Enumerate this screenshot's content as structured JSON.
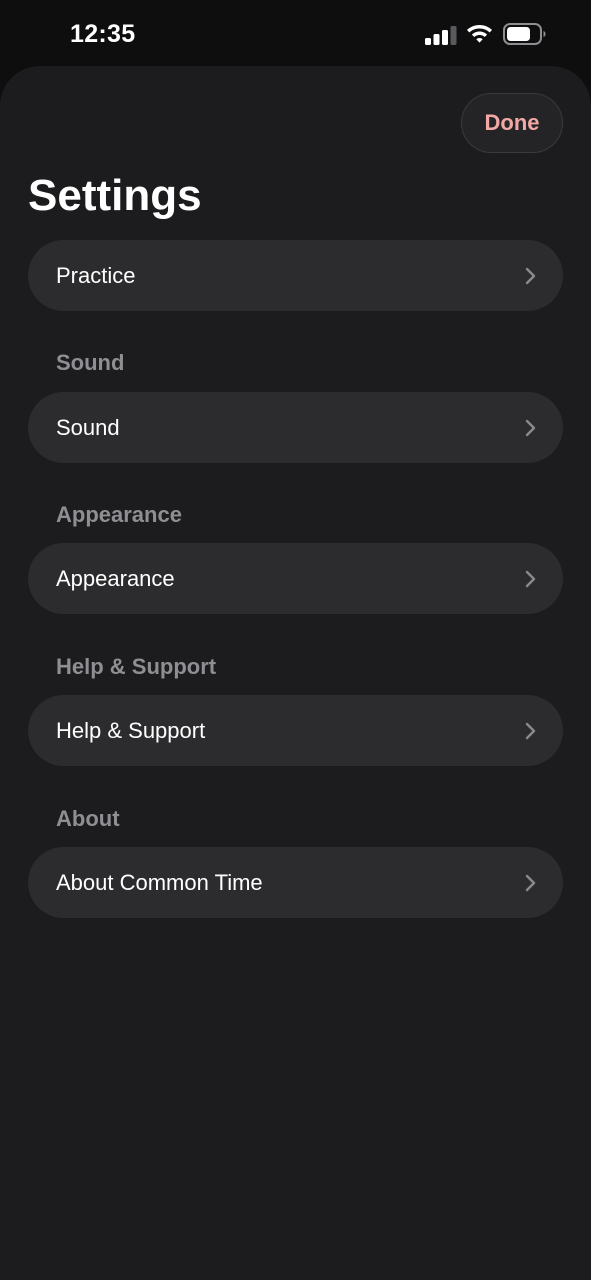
{
  "status_bar": {
    "time": "12:35",
    "icons": [
      "signal-icon",
      "wifi-icon",
      "battery-icon"
    ]
  },
  "header": {
    "title": "Settings",
    "done_label": "Done"
  },
  "sections": [
    {
      "header": "",
      "row_label": "Practice"
    },
    {
      "header": "Sound",
      "row_label": "Sound"
    },
    {
      "header": "Appearance",
      "row_label": "Appearance"
    },
    {
      "header": "Help & Support",
      "row_label": "Help & Support"
    },
    {
      "header": "About",
      "row_label": "About Common Time"
    }
  ],
  "colors": {
    "background": "#1c1c1e",
    "row_background": "#2c2c2e",
    "accent": "#f2a9a6",
    "section_header": "#8e8e93"
  }
}
